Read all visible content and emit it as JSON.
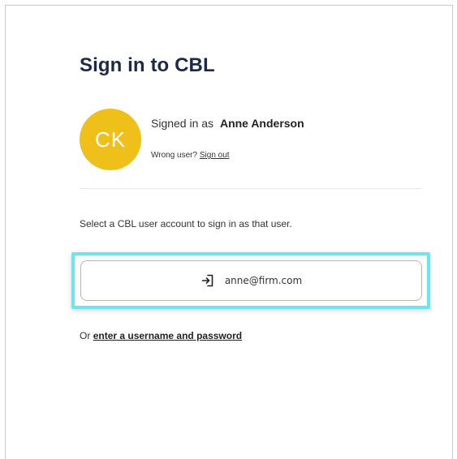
{
  "page": {
    "title": "Sign in to CBL"
  },
  "user": {
    "avatar_initials": "CK",
    "avatar_color": "#efc01a",
    "signed_in_prefix": "Signed in as",
    "name": "Anne Anderson",
    "wrong_user_prefix": "Wrong user?",
    "sign_out_label": "Sign out"
  },
  "instruction": "Select a CBL user account to sign in as that user.",
  "accounts": [
    {
      "email": "anne@firm.com",
      "icon": "sign-in-icon"
    }
  ],
  "highlight_color": "#6ce6ea",
  "alternative": {
    "prefix": "Or",
    "link_label": "enter a username and password"
  }
}
